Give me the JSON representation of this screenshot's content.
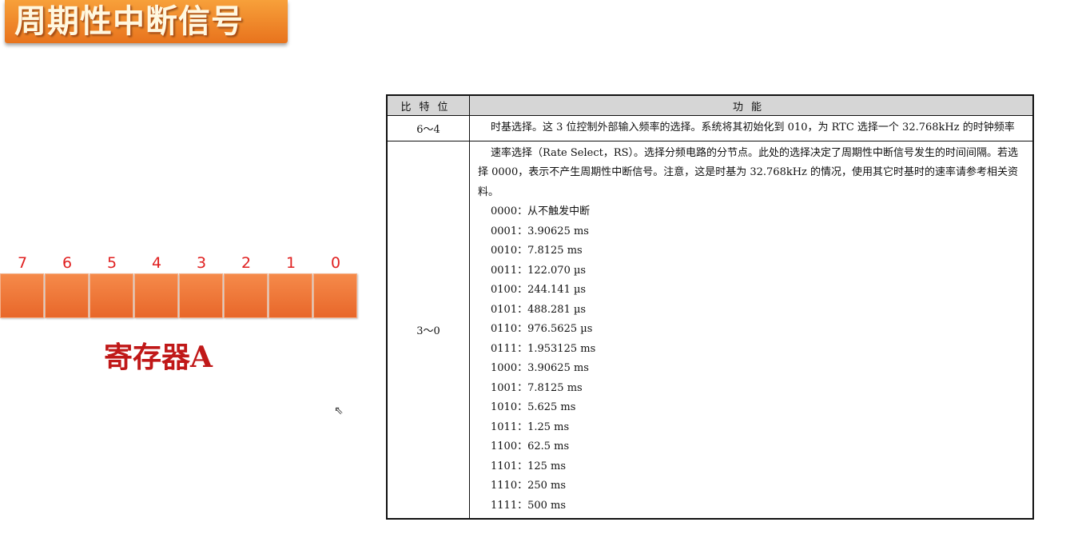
{
  "title": "周期性中断信号",
  "register": {
    "bits": [
      "7",
      "6",
      "5",
      "4",
      "3",
      "2",
      "1",
      "0"
    ],
    "label": "寄存器A"
  },
  "table": {
    "headers": {
      "bit": "比特位",
      "function": "功能"
    },
    "row1": {
      "bits": "6～4",
      "text": "时基选择。这 3 位控制外部输入频率的选择。系统将其初始化到 010，为 RTC 选择一个 32.768kHz 的时钟频率"
    },
    "row2": {
      "bits": "3～0",
      "text": "速率选择（Rate Select，RS）。选择分频电路的分节点。此处的选择决定了周期性中断信号发生的时间间隔。若选择 0000，表示不产生周期性中断信号。注意，这是时基为 32.768kHz 的情况，使用其它时基时的速率请参考相关资料。",
      "rates": [
        "0000：从不触发中断",
        "0001：3.90625 ms",
        "0010：7.8125 ms",
        "0011：122.070 µs",
        "0100：244.141 µs",
        "0101：488.281 µs",
        "0110：976.5625 µs",
        "0111：1.953125 ms",
        "1000：3.90625 ms",
        "1001：7.8125 ms",
        "1010：5.625 ms",
        "1011：1.25 ms",
        "1100：62.5 ms",
        "1101：125 ms",
        "1110：250 ms",
        "1111：500 ms"
      ]
    }
  }
}
